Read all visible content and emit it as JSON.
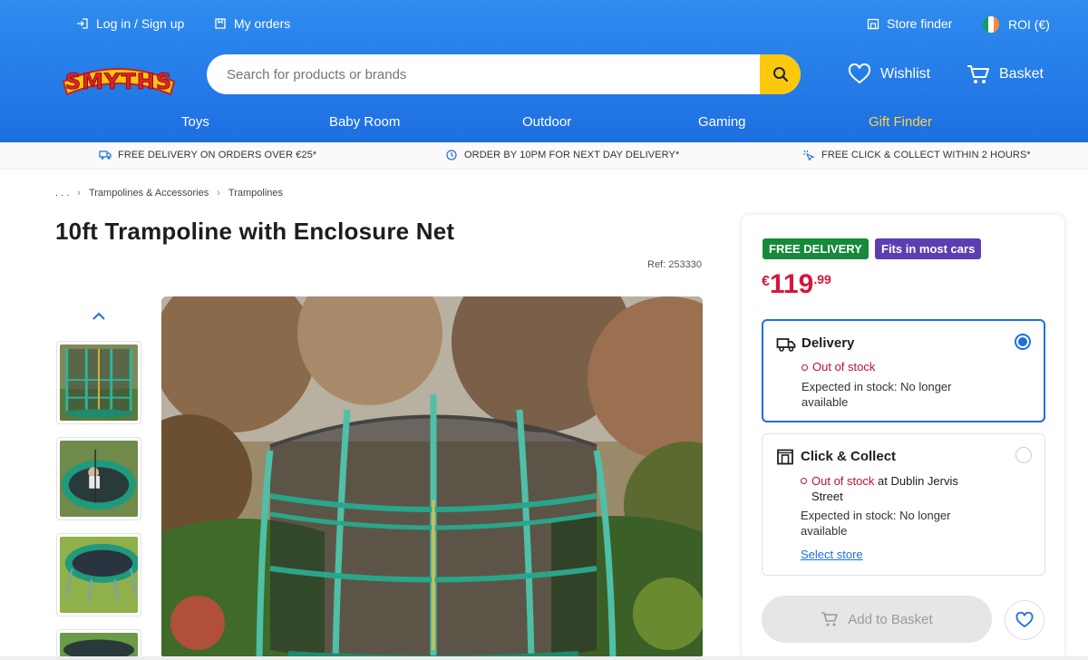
{
  "header": {
    "login_label": "Log in / Sign up",
    "orders_label": "My orders",
    "store_finder_label": "Store finder",
    "region_label": "ROI (€)",
    "logo_text": "SMYTHS",
    "search": {
      "placeholder": "Search for products or brands"
    },
    "wishlist_label": "Wishlist",
    "basket_label": "Basket",
    "nav": [
      "Toys",
      "Baby Room",
      "Outdoor",
      "Gaming",
      "Gift Finder"
    ],
    "brand_color": "#1e6fe0",
    "accent_color": "#fbc80d"
  },
  "infobar": {
    "delivery": "FREE DELIVERY ON ORDERS OVER €25*",
    "next_day": "ORDER BY 10PM FOR NEXT DAY DELIVERY*",
    "click_collect": "FREE CLICK & COLLECT WITHIN 2 HOURS*"
  },
  "breadcrumb": {
    "ellipsis": ". . .",
    "items": [
      "Trampolines & Accessories",
      "Trampolines"
    ]
  },
  "product": {
    "title": "10ft Trampoline with Enclosure Net",
    "ref": "Ref: 253330",
    "badges": {
      "delivery": "FREE DELIVERY",
      "cars": "Fits in most cars"
    },
    "price": {
      "currency": "€",
      "whole": "119",
      "cents": ".99"
    }
  },
  "options": {
    "delivery": {
      "title": "Delivery",
      "stock": "Out of stock",
      "expected": "Expected in stock: No longer available",
      "selected": true
    },
    "collect": {
      "title": "Click & Collect",
      "stock": "Out of stock",
      "store_prefix": "at",
      "store": "Dublin Jervis Street",
      "expected": "Expected in stock: No longer available",
      "link": "Select store",
      "selected": false
    }
  },
  "actions": {
    "add_to_basket": "Add to Basket"
  },
  "icons": {
    "login": "login-icon",
    "orders": "orders-icon",
    "store": "store-icon",
    "flag": "ireland-flag-icon",
    "search": "search-icon",
    "wishlist": "heart-icon",
    "basket": "cart-icon",
    "truck": "truck-icon",
    "clock": "clock-icon",
    "collect": "click-collect-icon",
    "chevron_up": "chevron-up-icon"
  }
}
